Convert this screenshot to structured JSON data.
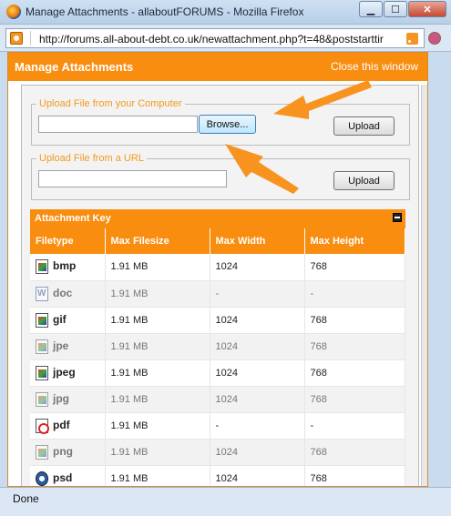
{
  "window": {
    "title": "Manage Attachments - allaboutFORUMS - Mozilla Firefox",
    "minimize": "▁",
    "maximize": "☐",
    "close": "✕"
  },
  "address": {
    "url": "http://forums.all-about-debt.co.uk/newattachment.php?t=48&poststarttir"
  },
  "dialog": {
    "title": "Manage Attachments",
    "close_link": "Close this window"
  },
  "upload_computer": {
    "legend": "Upload File from your Computer",
    "file_value": "",
    "browse_label": "Browse...",
    "upload_label": "Upload"
  },
  "upload_url": {
    "legend": "Upload File from a URL",
    "url_value": "",
    "upload_label": "Upload"
  },
  "attachment_key": {
    "title": "Attachment Key",
    "columns": [
      "Filetype",
      "Max Filesize",
      "Max Width",
      "Max Height"
    ],
    "rows": [
      {
        "type": "bmp",
        "icon": "image-file-icon",
        "size": "1.91 MB",
        "width": "1024",
        "height": "768"
      },
      {
        "type": "doc",
        "icon": "word-doc-icon",
        "size": "1.91 MB",
        "width": "-",
        "height": "-"
      },
      {
        "type": "gif",
        "icon": "image-file-icon",
        "size": "1.91 MB",
        "width": "1024",
        "height": "768"
      },
      {
        "type": "jpe",
        "icon": "image-file-icon",
        "size": "1.91 MB",
        "width": "1024",
        "height": "768"
      },
      {
        "type": "jpeg",
        "icon": "image-file-icon",
        "size": "1.91 MB",
        "width": "1024",
        "height": "768"
      },
      {
        "type": "jpg",
        "icon": "image-file-icon",
        "size": "1.91 MB",
        "width": "1024",
        "height": "768"
      },
      {
        "type": "pdf",
        "icon": "pdf-file-icon",
        "size": "1.91 MB",
        "width": "-",
        "height": "-"
      },
      {
        "type": "png",
        "icon": "image-file-icon",
        "size": "1.91 MB",
        "width": "1024",
        "height": "768"
      },
      {
        "type": "psd",
        "icon": "psd-file-icon",
        "size": "1.91 MB",
        "width": "1024",
        "height": "768"
      }
    ]
  },
  "status": {
    "text": "Done"
  },
  "colors": {
    "accent": "#f88d10",
    "arrow": "#f7931e"
  }
}
